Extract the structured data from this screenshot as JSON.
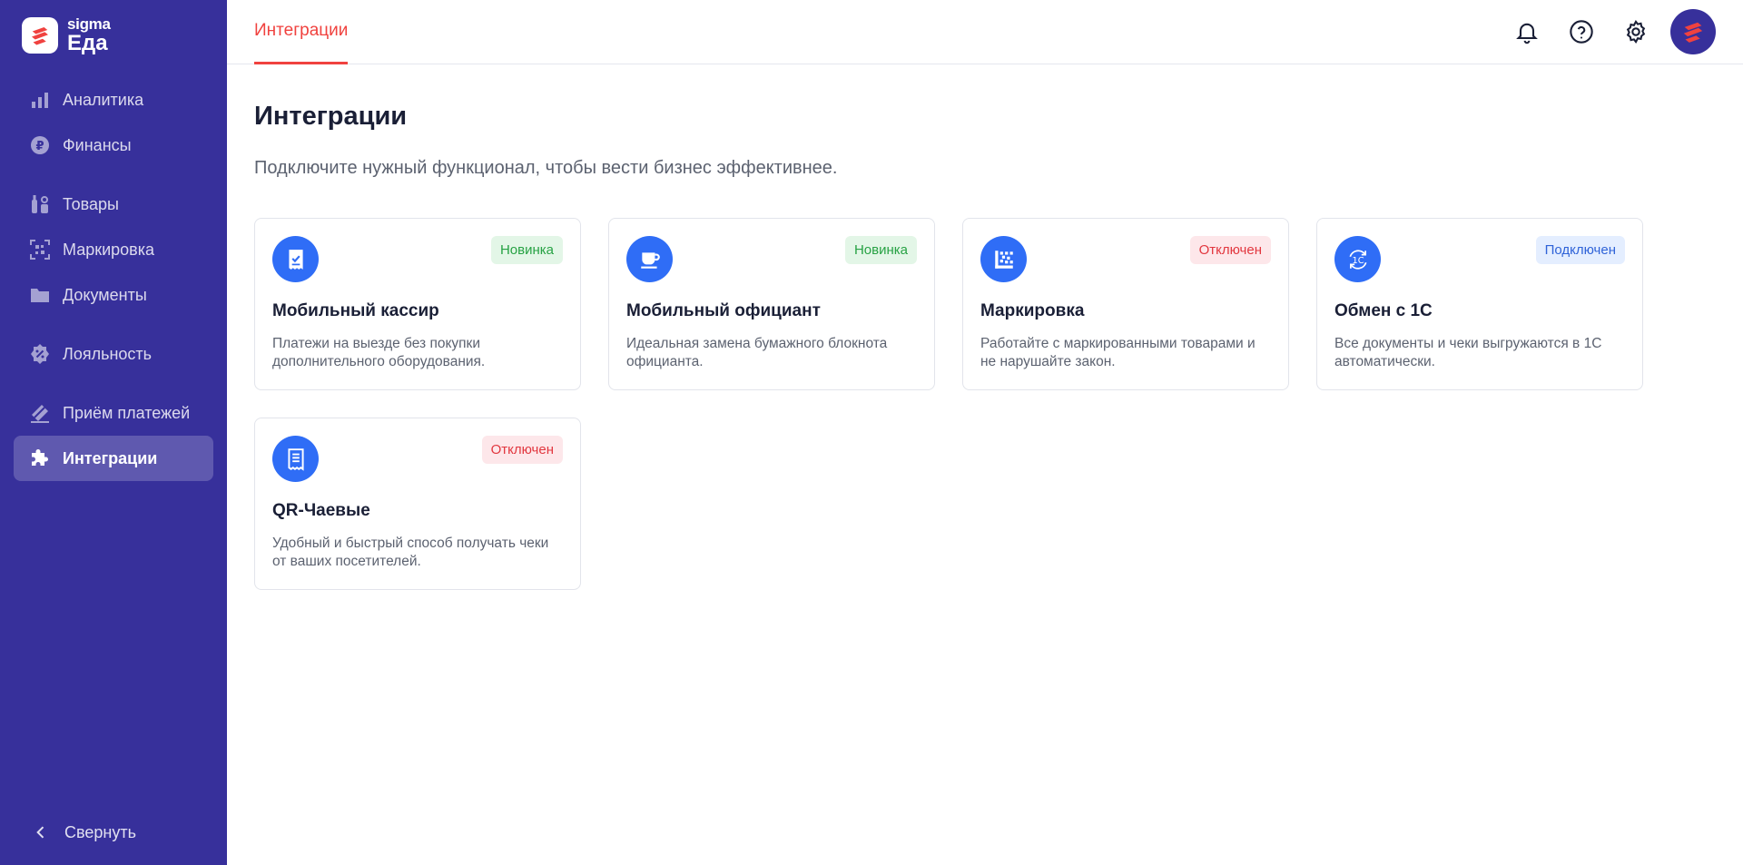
{
  "brand": {
    "sigma": "sigma",
    "eda": "Еда",
    "accent": "#f0423f",
    "sidebar_bg": "#37309b"
  },
  "sidebar": {
    "items": [
      {
        "label": "Аналитика",
        "icon": "bar-chart-icon",
        "active": false
      },
      {
        "label": "Финансы",
        "icon": "ruble-coin-icon",
        "active": false
      },
      {
        "label": "Товары",
        "icon": "bottles-icon",
        "active": false
      },
      {
        "label": "Маркировка",
        "icon": "barcode-scan-icon",
        "active": false
      },
      {
        "label": "Документы",
        "icon": "folder-icon",
        "active": false
      },
      {
        "label": "Лояльность",
        "icon": "percent-badge-icon",
        "active": false
      },
      {
        "label": "Приём платежей",
        "icon": "card-icon",
        "active": false
      },
      {
        "label": "Интеграции",
        "icon": "puzzle-icon",
        "active": true
      }
    ],
    "collapse_label": "Свернуть"
  },
  "header": {
    "tab_label": "Интеграции"
  },
  "main": {
    "title": "Интеграции",
    "subtitle": "Подключите нужный функционал, чтобы вести бизнес эффективнее.",
    "cards": [
      {
        "title": "Мобильный кассир",
        "description": "Платежи на выезде без покупки дополнительного оборудования.",
        "badge": "Новинка",
        "status": "new",
        "icon": "receipt-check-icon"
      },
      {
        "title": "Мобильный официант",
        "description": "Идеальная замена бумажного блокнота официанта.",
        "badge": "Новинка",
        "status": "new",
        "icon": "coffee-cup-icon"
      },
      {
        "title": "Маркировка",
        "description": "Работайте с маркированными товарами и не нарушайте закон.",
        "badge": "Отключен",
        "status": "off",
        "icon": "datamatrix-icon"
      },
      {
        "title": "Обмен с 1С",
        "description": "Все документы и чеки выгружаются в 1С автоматически.",
        "badge": "Подключен",
        "status": "on",
        "icon": "sync-1c-icon"
      },
      {
        "title": "QR-Чаевые",
        "description": "Удобный и быстрый способ получать чеки от ваших посетителей.",
        "badge": "Отключен",
        "status": "off",
        "icon": "receipt-list-icon"
      }
    ]
  }
}
